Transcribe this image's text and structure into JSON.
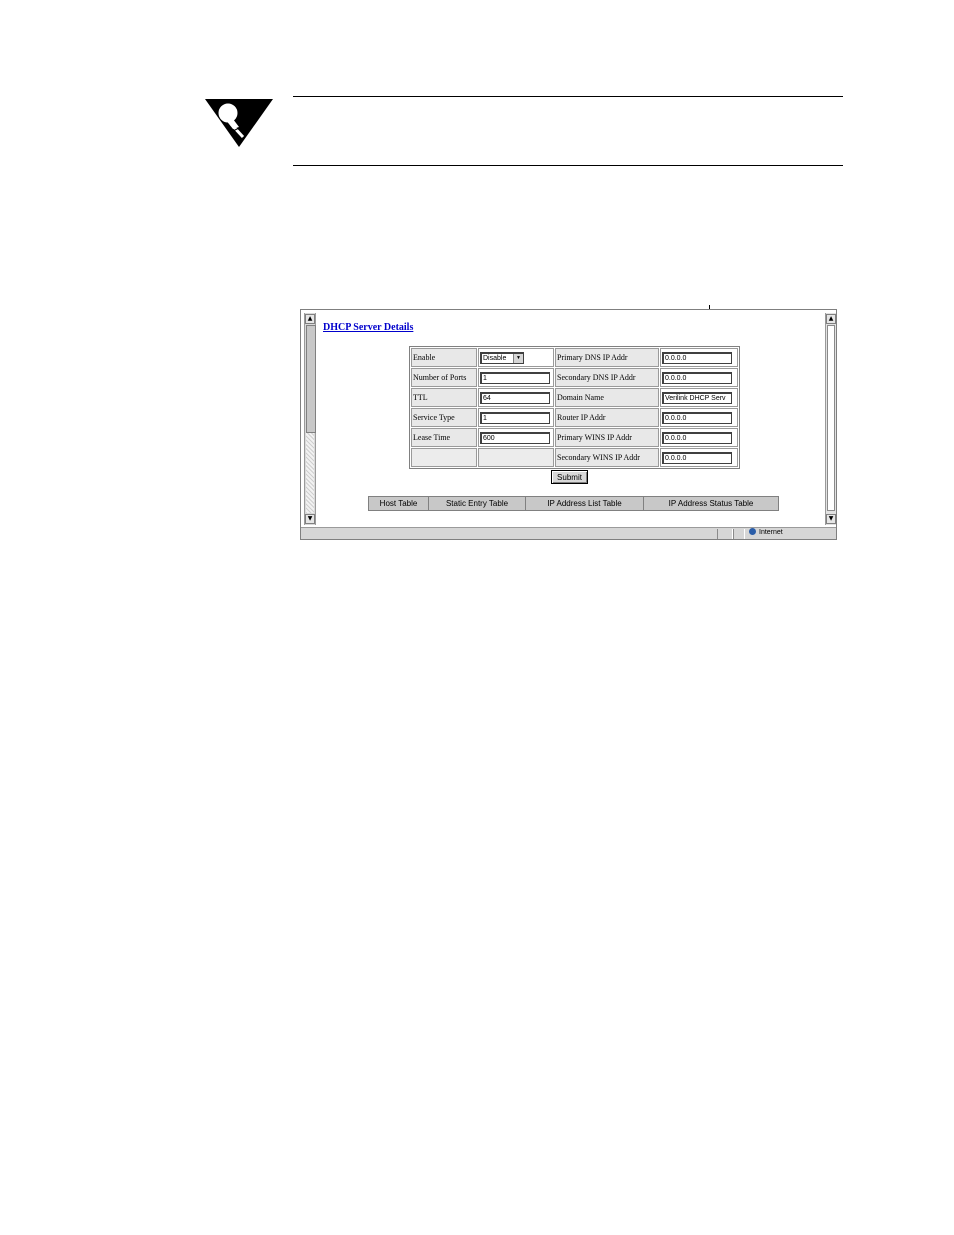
{
  "page": {
    "title": "DHCP Server Details",
    "fields": {
      "enable": {
        "label": "Enable",
        "value": "Disable"
      },
      "num_ports": {
        "label": "Number of Ports",
        "value": "1"
      },
      "ttl": {
        "label": "TTL",
        "value": "64"
      },
      "service_type": {
        "label": "Service Type",
        "value": "1"
      },
      "lease_time": {
        "label": "Lease Time",
        "value": "600"
      },
      "primary_dns": {
        "label": "Primary DNS IP Addr",
        "value": "0.0.0.0"
      },
      "secondary_dns": {
        "label": "Secondary DNS IP Addr",
        "value": "0.0.0.0"
      },
      "domain_name": {
        "label": "Domain Name",
        "value": "Verilink DHCP Serv"
      },
      "router_ip": {
        "label": "Router IP Addr",
        "value": "0.0.0.0"
      },
      "primary_wins": {
        "label": "Primary WINS IP Addr",
        "value": "0.0.0.0"
      },
      "secondary_wins": {
        "label": "Secondary WINS IP Addr",
        "value": "0.0.0.0"
      }
    },
    "submit_label": "Submit",
    "nav": [
      "Host Table",
      "Static Entry Table",
      "IP Address List Table",
      "IP Address Status Table"
    ]
  },
  "status_bar": {
    "zone": "Internet"
  },
  "icons": {
    "note": "lightbulb-note-icon",
    "zone": "globe-icon"
  }
}
